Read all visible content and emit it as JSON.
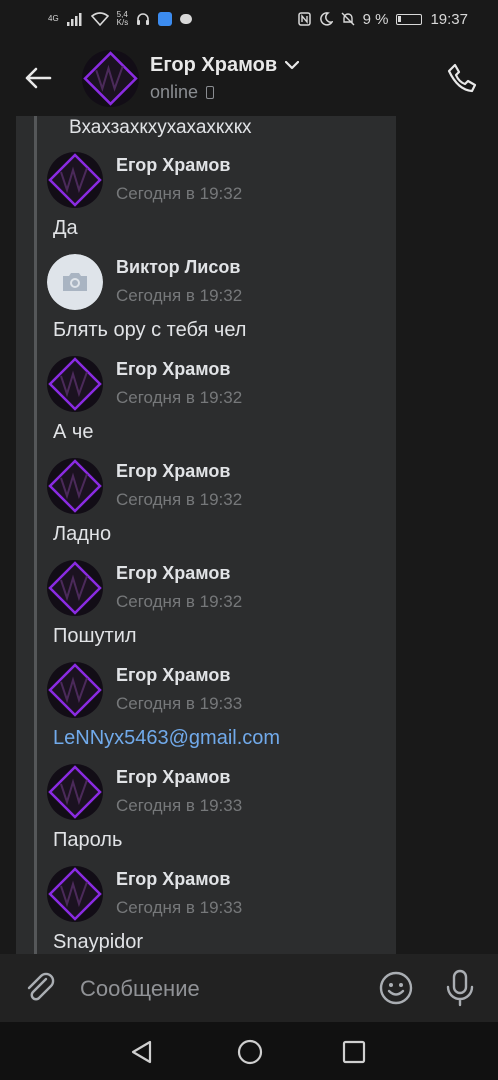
{
  "status_bar": {
    "network": "4G",
    "speed_value": "5,4",
    "speed_unit": "K/s",
    "battery": "9 %",
    "time": "19:37"
  },
  "header": {
    "name": "Егор Храмов",
    "status": "online"
  },
  "chat": {
    "top_text": "Вхахзахкхухахахкхкх",
    "messages": [
      {
        "sender": "Егор Храмов",
        "time": "Сегодня в 19:32",
        "text": "Да",
        "avatar": "dark",
        "link": false
      },
      {
        "sender": "Виктор Лисов",
        "time": "Сегодня в 19:32",
        "text": "Блять ору с тебя чел",
        "avatar": "camera",
        "link": false
      },
      {
        "sender": "Егор Храмов",
        "time": "Сегодня в 19:32",
        "text": "А че",
        "avatar": "dark",
        "link": false
      },
      {
        "sender": "Егор Храмов",
        "time": "Сегодня в 19:32",
        "text": "Ладно",
        "avatar": "dark",
        "link": false
      },
      {
        "sender": "Егор Храмов",
        "time": "Сегодня в 19:32",
        "text": "Пошутил",
        "avatar": "dark",
        "link": false
      },
      {
        "sender": "Егор Храмов",
        "time": "Сегодня в 19:33",
        "text": "LeNNyx5463@gmail.com",
        "avatar": "dark",
        "link": true
      },
      {
        "sender": "Егор Храмов",
        "time": "Сегодня в 19:33",
        "text": "Пароль",
        "avatar": "dark",
        "link": false
      },
      {
        "sender": "Егор Храмов",
        "time": "Сегодня в 19:33",
        "text": "Snaypidor",
        "avatar": "dark",
        "link": false
      }
    ]
  },
  "composer": {
    "placeholder": "Сообщение"
  },
  "colors": {
    "background": "#191919",
    "bubble": "#2c2d2e",
    "link": "#71aaeb",
    "muted": "#76787a",
    "accent_purple": "#8a2be2"
  }
}
